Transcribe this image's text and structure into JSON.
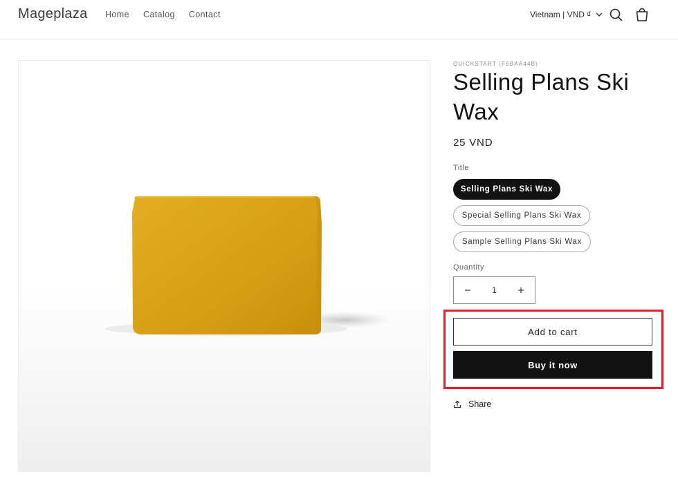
{
  "header": {
    "logo": "Mageplaza",
    "nav": [
      "Home",
      "Catalog",
      "Contact"
    ],
    "locale": "Vietnam | VND ₫"
  },
  "product": {
    "vendor": "QUICKSTART (F6BAA44B)",
    "title": "Selling Plans Ski Wax",
    "price": "25 VND",
    "option_label": "Title",
    "options": [
      {
        "label": "Selling Plans Ski Wax",
        "selected": true
      },
      {
        "label": "Special Selling Plans Ski Wax",
        "selected": false
      },
      {
        "label": "Sample Selling Plans Ski Wax",
        "selected": false
      }
    ],
    "quantity_label": "Quantity",
    "quantity": "1",
    "add_to_cart": "Add to cart",
    "buy_now": "Buy it now",
    "share": "Share"
  },
  "colors": {
    "highlight": "#ec1c24",
    "primary": "#121212",
    "wax": "#dba11a"
  }
}
